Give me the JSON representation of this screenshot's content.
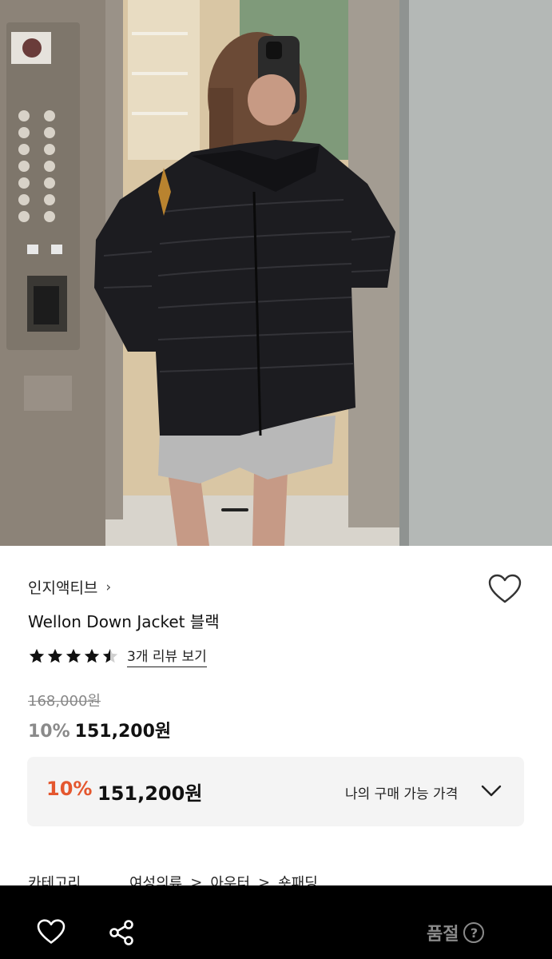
{
  "product_image": {
    "alt": "Wellon Down Jacket 블랙",
    "colors": {
      "jacket": "#1c1c20",
      "shorts": "#b8b8b8",
      "elevator_panel": "#8c8378",
      "wall": "#b4b8b6"
    }
  },
  "product": {
    "brand": "인지액티브",
    "brand_chevron": "›",
    "title": "Wellon Down Jacket 블랙",
    "rating": 4.5,
    "review_link": "3개 리뷰 보기",
    "original_price": "168,000원",
    "discount": "10%",
    "sale_price": "151,200원"
  },
  "my_price": {
    "discount": "10%",
    "price": "151,200원",
    "label": "나의 구매 가능 가격"
  },
  "category": {
    "label": "카테고리",
    "path": [
      "여성의류",
      "아우터",
      "숏패딩"
    ],
    "separator": ">"
  },
  "bottom_bar": {
    "soldout_label": "품절",
    "help_glyph": "?"
  },
  "colors": {
    "discount_accent": "#e4572e",
    "muted": "#8a8a8a",
    "bar_bg": "#000000"
  },
  "icons": [
    "heart-icon",
    "chevron-right-icon",
    "star-icon",
    "chevron-down-icon",
    "share-icon",
    "help-icon"
  ]
}
